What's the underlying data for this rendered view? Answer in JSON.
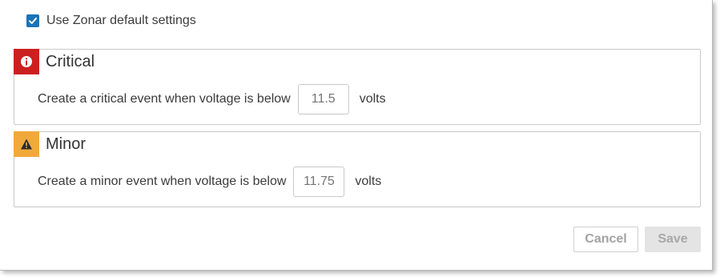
{
  "defaults": {
    "checkbox_checked": true,
    "label": "Use Zonar default settings"
  },
  "critical": {
    "title": "Critical",
    "icon": "info-circle-icon",
    "icon_color": "#cc1f1f",
    "rule_text": "Create a critical event when voltage is below",
    "placeholder": "11.5",
    "unit": "volts"
  },
  "minor": {
    "title": "Minor",
    "icon": "warning-triangle-icon",
    "icon_color": "#f2a93b",
    "rule_text": "Create a minor event when voltage is below",
    "placeholder": "11.75",
    "unit": "volts"
  },
  "actions": {
    "cancel_label": "Cancel",
    "save_label": "Save"
  },
  "colors": {
    "accent": "#1a73b8"
  }
}
